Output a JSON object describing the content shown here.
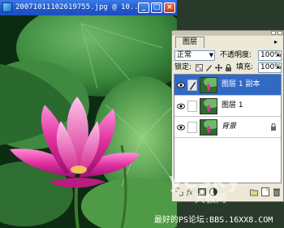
{
  "photo_window": {
    "title": "20071011102619755.jpg @ 10...",
    "minimize": "_",
    "maximize": "□",
    "close": "×"
  },
  "layers_panel": {
    "tab": "图层",
    "menu": "▸",
    "blend_mode": "正常",
    "opacity_label": "不透明度:",
    "opacity_value": "100%",
    "lock_label": "锁定:",
    "fill_label": "填充:",
    "fill_value": "100%",
    "layers": [
      {
        "name": "图层 1 副本",
        "selected": true
      },
      {
        "name": "图层 1",
        "selected": false
      },
      {
        "name": "背景",
        "selected": false,
        "locked": true
      }
    ]
  },
  "watermark": {
    "brand": "yesky",
    "sub": "天极网"
  },
  "caption": "最好的PS论坛:BBS.16XX8.COM",
  "colors": {
    "titlebar": "#1f56c9",
    "panel_bg": "#ece9d8",
    "selection": "#316ac5"
  }
}
